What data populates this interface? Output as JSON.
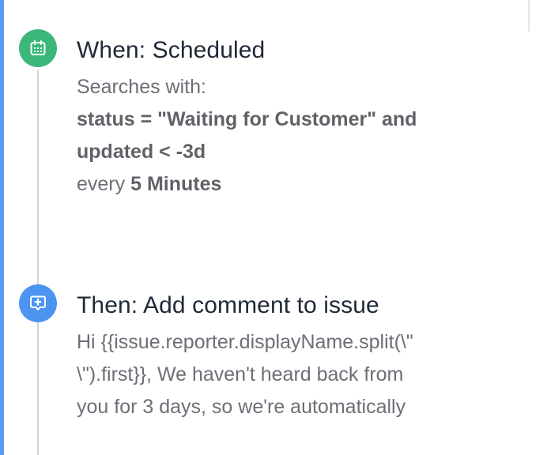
{
  "trigger": {
    "icon": "calendar-icon",
    "color": "#3cb77a",
    "title": "When: Scheduled",
    "searches_label": "Searches with:",
    "jql_line_1": "status = \"Waiting for Customer\" and",
    "jql_line_2": "updated < -3d",
    "every_label": "every",
    "interval": "5 Minutes"
  },
  "action": {
    "icon": "comment-add-icon",
    "color": "#4c94f0",
    "title": "Then: Add comment to issue",
    "comment_lines": [
      "Hi {{issue.reporter.displayName.split(\\\"",
      "\\\").first}}, We haven't heard back from",
      "you for 3 days, so we're automatically"
    ]
  },
  "accent_color": "#5b9cf3"
}
